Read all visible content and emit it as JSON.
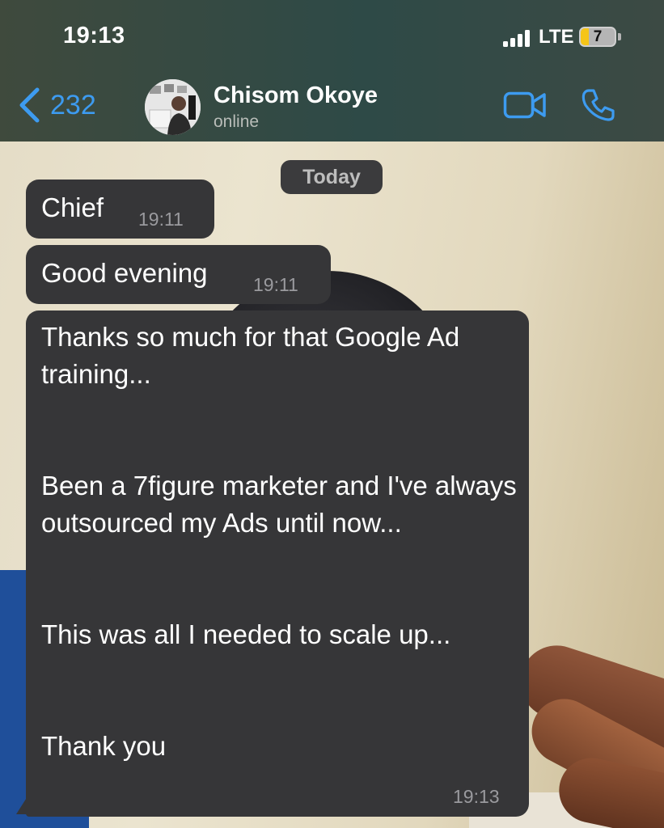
{
  "status_bar": {
    "time": "19:13",
    "network": "LTE",
    "battery": "7"
  },
  "header": {
    "back_count": "232",
    "contact_name": "Chisom Okoye",
    "contact_status": "online",
    "icons": [
      "chevron-left-icon",
      "video-camera-icon",
      "phone-icon"
    ],
    "accent_color": "#3d9bf0"
  },
  "chat": {
    "date_label": "Today",
    "messages": [
      {
        "text": "Chief",
        "time": "19:11"
      },
      {
        "text": "Good evening",
        "time": "19:11"
      },
      {
        "text": "Thanks so much for that Google Ad training...\n\n\nBeen a 7figure marketer and I've always outsourced my Ads until now...\n\n\nThis was all I needed to scale up...\n\n\nThank you",
        "time": "19:13"
      }
    ]
  }
}
